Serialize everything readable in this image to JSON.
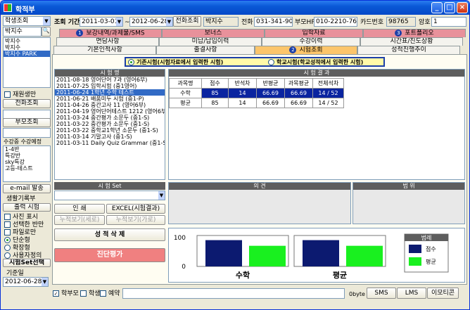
{
  "window": {
    "title": "학적부",
    "controls": [
      "_",
      "□",
      "×"
    ]
  },
  "left": {
    "mode_select": "학생조회",
    "search_value": "박지수",
    "students": [
      "박지수",
      "박지수",
      "박지수 PARK"
    ],
    "cb_withdrawn": "재원생만",
    "btn_phone": "전화조회",
    "btn_parent": "부모조회",
    "lbl_courses": "수강중 수강예정",
    "courses": [
      "1-4반",
      "특강반",
      "sky특강",
      "고등-테스트"
    ],
    "btn_email": "e-mail 발송",
    "lbl_record": "생활기록부",
    "btn_print": "출력 시험",
    "opt_photo": "사진 표시",
    "opt_half": "선택한 반만",
    "opt_file": "파일로만",
    "opt_single": "단순형",
    "opt_expand": "확장형",
    "opt_user": "사용자정의",
    "btn_test_set": "시험Set선택",
    "lbl_base_month": "기준일",
    "base_month": "2012-06-28"
  },
  "top": {
    "lbl_period": "조회 기간",
    "date_from": "2011-03-01",
    "date_to": "2012-06-28",
    "btn_phone_lookup": "전화조회",
    "student_name": "박지수",
    "lbl_home": "전화",
    "home_phone": "031-341-9008",
    "lbl_parent_hp": "부모HP",
    "parent_hp": "010-2210-7663",
    "lbl_card": "카드번호",
    "card_no": "98765",
    "lbl_pw": "암호",
    "pw": "1"
  },
  "tabs": {
    "row1": [
      {
        "label": "보강내역/과제물/SMS",
        "num": "1"
      },
      {
        "label": "보너스"
      },
      {
        "label": "입학자료"
      },
      {
        "label": "포트폴리오",
        "num": "3"
      }
    ],
    "row2": [
      {
        "label": "면담사항"
      },
      {
        "label": "미납/납입이력"
      },
      {
        "label": "수강이력"
      },
      {
        "label": "시간표/진도상황"
      }
    ],
    "row3": [
      {
        "label": "기본인적사항"
      },
      {
        "label": "출결사항"
      },
      {
        "label": "시험조회",
        "num": "2"
      },
      {
        "label": "성적진행추이"
      }
    ]
  },
  "radio": {
    "opt1": "기존시험(시험자료에서 입력한 시험)",
    "opt2": "학교시험(학교성적에서 입력한 시험)"
  },
  "exam_list": {
    "header": "시 험 명",
    "items": [
      "2011-08-18 영어단어 7과 (영어6부)",
      "2011-07-25 입학시험 (중1영어)",
      "2011-06-24 1학년 수학 테스트",
      "2011-06-21 배품미두 시험 (중1-P)",
      "2011-04-26 중간고사 11 (영어6부)",
      "2011-04-19 영어단어테스트 1212 (영어6부)",
      "2011-03-24 중간평가 소문두 (중1-S)",
      "2011-03-22 중간평가 소문두 (중1-S)",
      "2011-03-22 중학교1학년 소문두 (중1-S)",
      "2011-03-14 기말고사 (중1-S)",
      "2011-03-11 Daily Quiz Grammar (중1-S)"
    ]
  },
  "exam_set": {
    "header": "시 험 Set",
    "value": ""
  },
  "buttons": {
    "print": "인 쇄",
    "excel": "EXCEL(시험결과)",
    "preview_new": "누적보기(세로)",
    "preview_old": "누적보기(가로)",
    "delete": "성 적 삭 제",
    "diag": "진단평가"
  },
  "results": {
    "header": "시 험 결 과",
    "cols": [
      "과목명",
      "점수",
      "반석차",
      "반평균",
      "과목평균",
      "전체석차"
    ],
    "rows": [
      [
        "수학",
        "85",
        "14",
        "66.69",
        "66.69",
        "14 / 52"
      ],
      [
        "평균",
        "85",
        "14",
        "66.69",
        "66.69",
        "14 / 52"
      ]
    ]
  },
  "opinion_header": "의 견",
  "range_header": "범 위",
  "chart_data": {
    "type": "bar",
    "categories": [
      "수학",
      "평균"
    ],
    "series": [
      {
        "name": "점수",
        "values": [
          85,
          85
        ],
        "color": "#0c1a70"
      },
      {
        "name": "평균",
        "values": [
          66.69,
          66.69
        ],
        "color": "#19f01f"
      }
    ],
    "ylim": [
      0,
      100
    ],
    "ytick_labels": [
      "100",
      "0"
    ],
    "legend_title": "범례",
    "legend_position": "right"
  },
  "bottom": {
    "cb_parent": "학부모",
    "cb_student": "학생",
    "cb_reserve": "예약",
    "byte": "0byte",
    "btn_sms": "SMS",
    "btn_lms": "LMS",
    "btn_emoticon": "이모티콘"
  }
}
